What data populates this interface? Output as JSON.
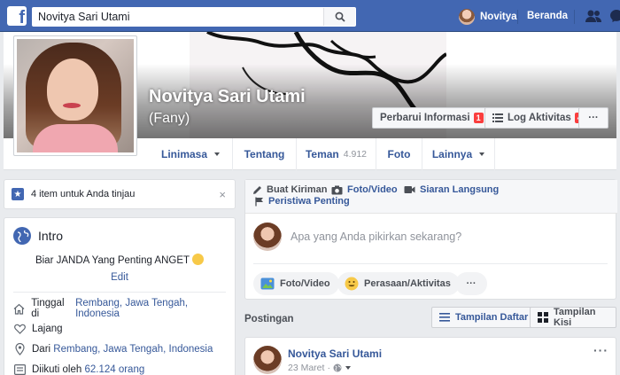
{
  "topbar": {
    "search_value": "Novitya Sari Utami",
    "user_name": "Novitya",
    "home_label": "Beranda"
  },
  "profile": {
    "name": "Novitya Sari Utami",
    "nickname": "(Fany)",
    "update_info_label": "Perbarui Informasi",
    "update_info_badge": "1",
    "activity_log_label": "Log Aktivitas",
    "activity_log_badge": "4",
    "more_label": "···"
  },
  "tabs": [
    {
      "label": "Linimasa"
    },
    {
      "label": "Tentang"
    },
    {
      "label": "Teman",
      "count": "4.912"
    },
    {
      "label": "Foto"
    },
    {
      "label": "Lainnya"
    }
  ],
  "review": {
    "text": "4 item untuk Anda tinjau",
    "close": "×"
  },
  "intro": {
    "title": "Intro",
    "bio": "Biar JANDA Yang Penting ANGET",
    "edit": "Edit",
    "lives_prefix": "Tinggal di",
    "lives_place": "Rembang, Jawa Tengah, Indonesia",
    "relationship": "Lajang",
    "from_prefix": "Dari",
    "from_place": "Rembang, Jawa Tengah, Indonesia",
    "followed_prefix": "Diikuti oleh",
    "followed_count": "62.124 orang"
  },
  "composer": {
    "tab_create": "Buat Kiriman",
    "tab_photo": "Foto/Video",
    "tab_live": "Siaran Langsung",
    "tab_event": "Peristiwa Penting",
    "placeholder": "Apa yang Anda pikirkan sekarang?",
    "btn_photo": "Foto/Video",
    "btn_feeling": "Perasaan/Aktivitas",
    "btn_more": "···"
  },
  "posts_section": {
    "label": "Postingan",
    "list_view": "Tampilan Daftar",
    "grid_view": "Tampilan Kisi"
  },
  "post": {
    "author": "Novitya Sari Utami",
    "date": "23 Maret",
    "more": "···"
  },
  "colors": {
    "brand": "#4267b2",
    "link": "#365899",
    "badge": "#fa3e3e",
    "background": "#e9ebee"
  }
}
